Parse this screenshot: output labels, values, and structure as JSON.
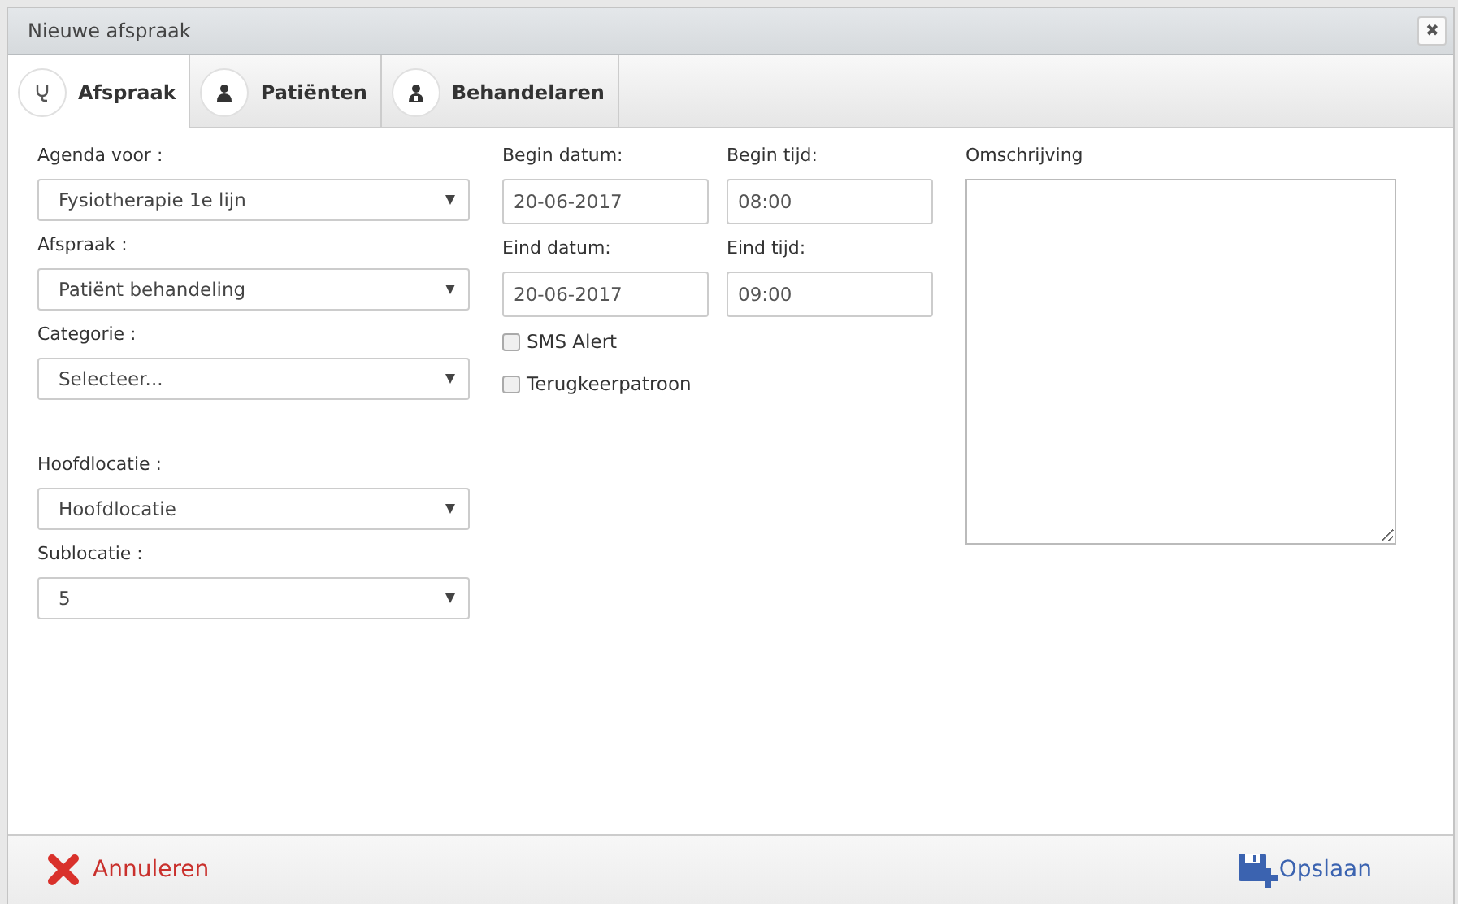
{
  "window": {
    "title": "Nieuwe afspraak",
    "close": "✖"
  },
  "tabs": [
    {
      "label": "Afspraak",
      "selected": true
    },
    {
      "label": "Patiënten",
      "selected": false
    },
    {
      "label": "Behandelaren",
      "selected": false
    }
  ],
  "left_fields": [
    {
      "label": "Agenda voor :",
      "value": "Fysiotherapie 1e lijn"
    },
    {
      "label": "Afspraak :",
      "value": "Patiënt behandeling"
    },
    {
      "label": "Categorie :",
      "value": "Selecteer..."
    },
    {
      "label": "Hoofdlocatie :",
      "value": "Hoofdlocatie"
    },
    {
      "label": "Sublocatie :",
      "value": "5"
    }
  ],
  "date_fields": [
    {
      "label": "Begin datum:",
      "value": "20-06-2017"
    },
    {
      "label": "Begin tijd:",
      "value": "08:00"
    },
    {
      "label": "Eind datum:",
      "value": "20-06-2017"
    },
    {
      "label": "Eind tijd:",
      "value": "09:00"
    }
  ],
  "checkboxes": [
    {
      "label": "SMS Alert",
      "checked": false
    },
    {
      "label": "Terugkeerpatroon",
      "checked": false
    }
  ],
  "description": {
    "label": "Omschrijving"
  },
  "footer": {
    "cancel": "Annuleren",
    "save": "Opslaan"
  }
}
